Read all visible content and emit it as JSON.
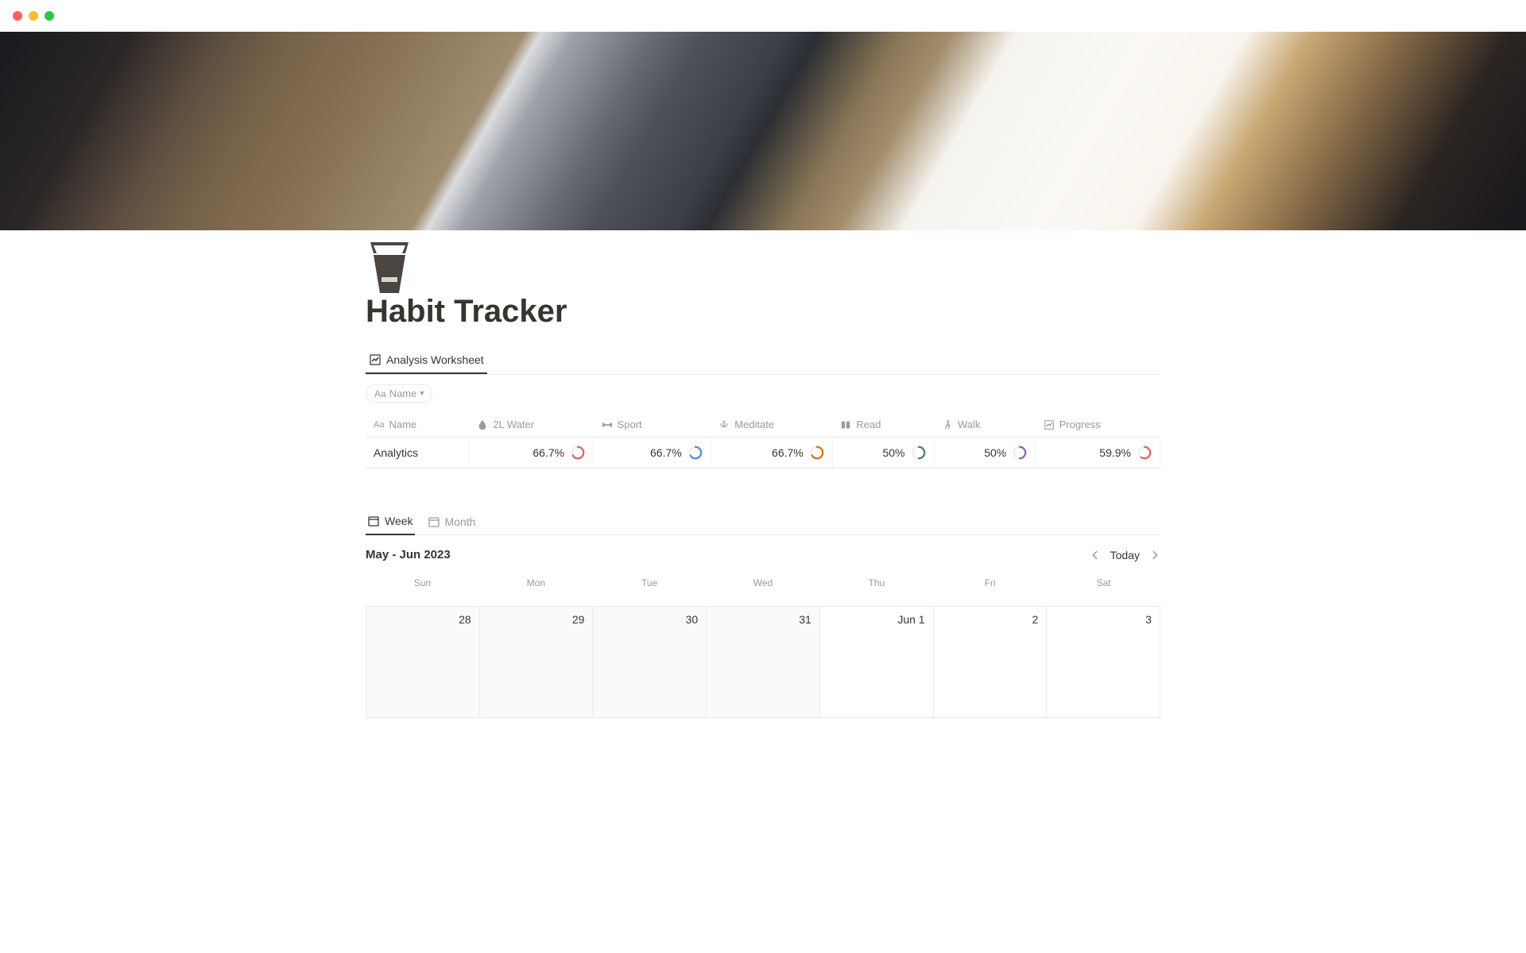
{
  "page": {
    "title": "Habit Tracker"
  },
  "analysis_db": {
    "tab_label": "Analysis Worksheet",
    "filter_label": "Name",
    "columns": [
      {
        "key": "name",
        "label": "Name",
        "icon": "text"
      },
      {
        "key": "water",
        "label": "2L Water",
        "icon": "drop"
      },
      {
        "key": "sport",
        "label": "Sport",
        "icon": "dumbbell"
      },
      {
        "key": "meditate",
        "label": "Meditate",
        "icon": "lotus"
      },
      {
        "key": "read",
        "label": "Read",
        "icon": "book"
      },
      {
        "key": "walk",
        "label": "Walk",
        "icon": "walk"
      },
      {
        "key": "progress",
        "label": "Progress",
        "icon": "chart"
      }
    ],
    "row": {
      "name": "Analytics",
      "water": "66.7%",
      "sport": "66.7%",
      "meditate": "66.7%",
      "read": "50%",
      "walk": "50%",
      "progress": "59.9%"
    },
    "ring_colors": {
      "water": "#e16259",
      "sport": "#4f8fd9",
      "meditate": "#d9730d",
      "read": "#448361",
      "walk": "#9065b0",
      "progress": "#e16259"
    },
    "ring_percent": {
      "water": 66.7,
      "sport": 66.7,
      "meditate": 66.7,
      "read": 50,
      "walk": 50,
      "progress": 59.9
    }
  },
  "calendar": {
    "tabs": [
      {
        "key": "week",
        "label": "Week",
        "active": true
      },
      {
        "key": "month",
        "label": "Month",
        "active": false
      }
    ],
    "range_label": "May - Jun 2023",
    "today_label": "Today",
    "day_headers": [
      "Sun",
      "Mon",
      "Tue",
      "Wed",
      "Thu",
      "Fri",
      "Sat"
    ],
    "days": [
      {
        "label": "28",
        "dim": true
      },
      {
        "label": "29",
        "dim": true
      },
      {
        "label": "30",
        "dim": true
      },
      {
        "label": "31",
        "dim": true
      },
      {
        "label": "Jun 1",
        "dim": false
      },
      {
        "label": "2",
        "dim": false
      },
      {
        "label": "3",
        "dim": false
      }
    ]
  }
}
